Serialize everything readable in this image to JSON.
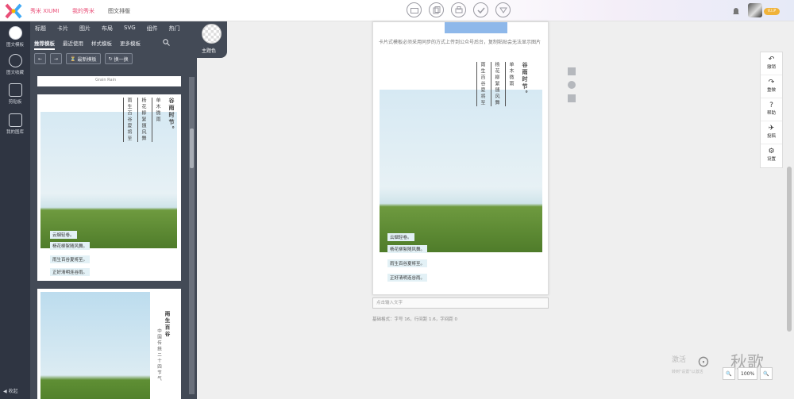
{
  "topbar": {
    "brand": "秀米 XIUMI",
    "my_xiumi": "我的秀米",
    "page": "图文排版"
  },
  "sidebar": {
    "items": [
      {
        "label": "图文模板"
      },
      {
        "label": "图文收藏"
      },
      {
        "label": "剪贴板"
      },
      {
        "label": "我的图库"
      }
    ],
    "collapse": "◀ 收起"
  },
  "panel": {
    "categories": [
      "标题",
      "卡片",
      "图片",
      "布局",
      "SVG",
      "组件",
      "热门"
    ],
    "subtabs": [
      "推荐模板",
      "最近使用",
      "样式模板",
      "更多模板"
    ],
    "theme_label": "主题色",
    "buttons": {
      "back": "←",
      "forward": "→",
      "latest": "最新模板",
      "shuffle": "换一换"
    },
    "card0_caption": "Grain Rain",
    "card1": {
      "title": "谷雨时节。",
      "cols": [
        "单木微雨",
        "杨花柳絮随风舞",
        "雨生百谷夏将至"
      ],
      "captions": [
        "云烟轻卷。",
        "杨花柳絮随风舞。",
        "雨生百谷夏将至。",
        "正好清明连谷雨。"
      ]
    },
    "card2": {
      "title": "雨生百谷",
      "sub": "中国传统二十四节气"
    }
  },
  "editor": {
    "note": "卡片式模板必须采用同步的方式上传到公众号后台，复制粘贴会无法显示图片",
    "title": "谷雨时节。",
    "cols": [
      "单木微雨",
      "杨花柳絮随风舞",
      "雨生百谷夏将至"
    ],
    "captions": [
      "云烟轻卷。",
      "杨花柳絮随风舞。",
      "雨生百谷夏将至。",
      "正好清明连谷雨。"
    ],
    "input_placeholder": "点击输入文字",
    "stats": "基础格式：字号 16，行间距 1.6，字间距 0"
  },
  "right_tools": [
    {
      "icon": "↶",
      "label": "撤销"
    },
    {
      "icon": "↷",
      "label": "重做"
    },
    {
      "icon": "?",
      "label": "帮助"
    },
    {
      "icon": "✈",
      "label": "投稿"
    },
    {
      "icon": "⚙",
      "label": "设置"
    }
  ],
  "watermark": {
    "line1": "激活",
    "line2": "转到\"设置\"以激活",
    "name": "秋歌",
    "wechat_icon": "wechat-icon"
  },
  "zoom": {
    "zoom_out": "🔍",
    "reset": "100%",
    "zoom_in": "🔍"
  }
}
